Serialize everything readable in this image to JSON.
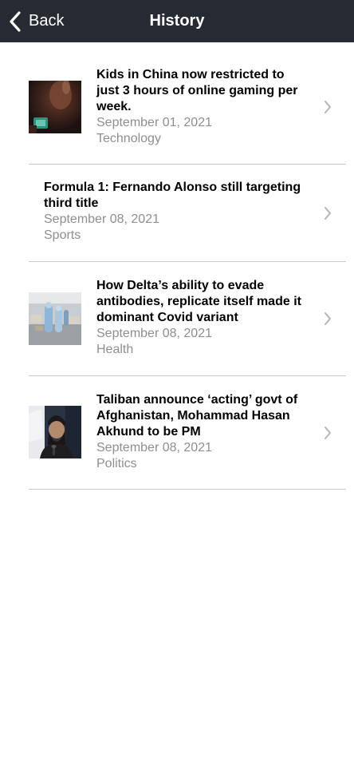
{
  "nav": {
    "back_label": "Back",
    "title": "History"
  },
  "articles": [
    {
      "title": "Kids in China now restricted to just 3 hours of online gaming per week.",
      "date": "September 01, 2021",
      "category": "Technology",
      "thumbnail": "child-phone-dark-photo"
    },
    {
      "title": "Formula 1: Fernando Alonso still targeting third title",
      "date": "September 08, 2021",
      "category": "Sports",
      "thumbnail": ""
    },
    {
      "title": "How Delta’s ability to evade antibodies, replicate itself made it dominant Covid variant",
      "date": "September 08, 2021",
      "category": "Health",
      "thumbnail": "hospital-ppe-workers-photo"
    },
    {
      "title": "Taliban announce ‘acting’ govt of Afghanistan, Mohammad Hasan Akhund to be PM",
      "date": "September 08, 2021",
      "category": "Politics",
      "thumbnail": "press-conference-speaker-photo"
    }
  ],
  "colors": {
    "navbar": "#262b33",
    "separator": "#c8c8c8",
    "secondary_text": "#8e8e93",
    "chevron": "#b4b4b4"
  }
}
